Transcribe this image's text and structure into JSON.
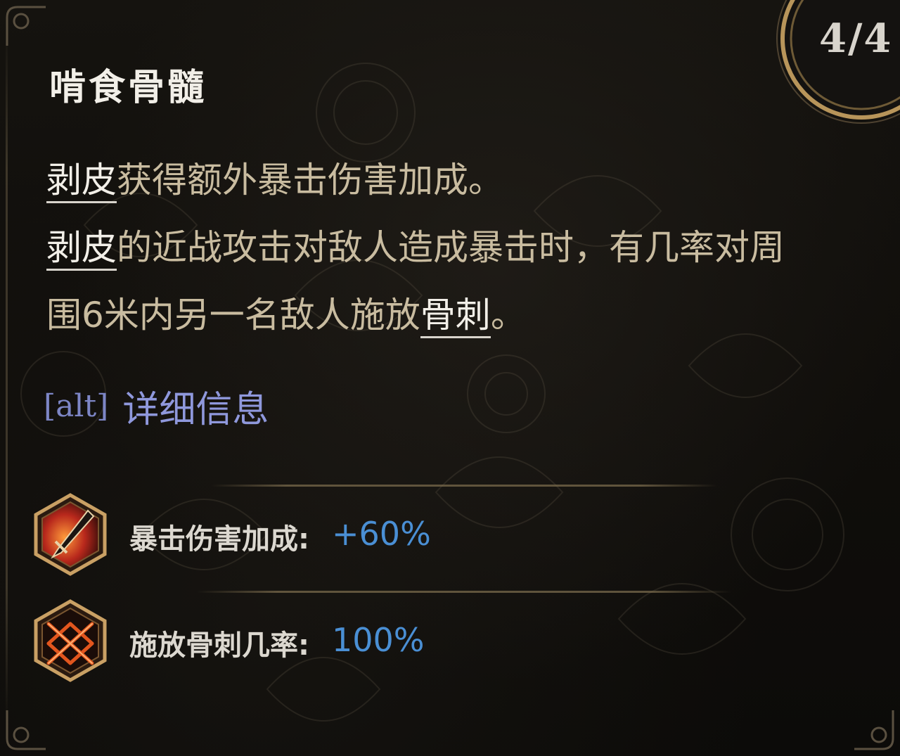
{
  "skill": {
    "name": "啃食骨髓",
    "rank": "4/4"
  },
  "description": {
    "line1": {
      "keyword": "剥皮",
      "rest": "获得额外暴击伤害加成。"
    },
    "line2": {
      "keyword": "剥皮",
      "rest": "的近战攻击对敌人造成暴击时，有几率对周"
    },
    "line3": {
      "lead": "围6米内另一名敌人施放",
      "keyword": "骨刺",
      "tail": "。"
    }
  },
  "details": {
    "key": "[alt]",
    "label": "详细信息"
  },
  "stats": [
    {
      "label": "暴击伤害加成:",
      "value": "+60%",
      "icon": "crit-damage-blade-icon"
    },
    {
      "label": "施放骨刺几率:",
      "value": "100%",
      "icon": "bone-spike-cross-icon"
    }
  ],
  "colors": {
    "title": "#f2efe8",
    "body_text": "#c9bca0",
    "keyword": "#f2efe8",
    "details_link": "#8f98dc",
    "stat_value": "#4a8fd4",
    "frame_gold": "#b8955a"
  }
}
